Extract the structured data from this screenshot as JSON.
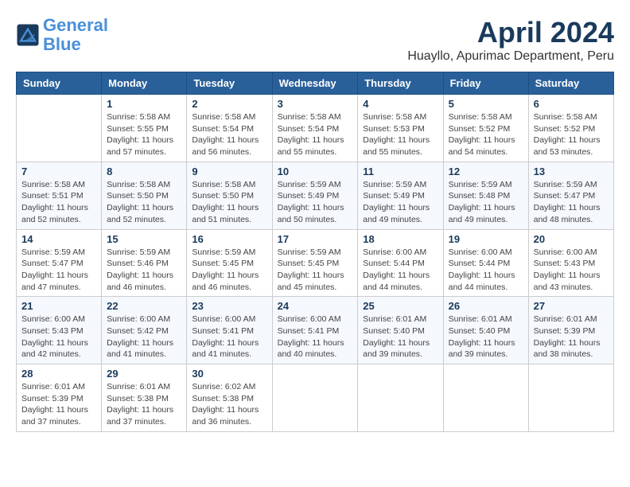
{
  "header": {
    "logo_line1": "General",
    "logo_line2": "Blue",
    "title": "April 2024",
    "location": "Huayllo, Apurimac Department, Peru"
  },
  "days_of_week": [
    "Sunday",
    "Monday",
    "Tuesday",
    "Wednesday",
    "Thursday",
    "Friday",
    "Saturday"
  ],
  "weeks": [
    [
      {
        "day": "",
        "info": ""
      },
      {
        "day": "1",
        "info": "Sunrise: 5:58 AM\nSunset: 5:55 PM\nDaylight: 11 hours\nand 57 minutes."
      },
      {
        "day": "2",
        "info": "Sunrise: 5:58 AM\nSunset: 5:54 PM\nDaylight: 11 hours\nand 56 minutes."
      },
      {
        "day": "3",
        "info": "Sunrise: 5:58 AM\nSunset: 5:54 PM\nDaylight: 11 hours\nand 55 minutes."
      },
      {
        "day": "4",
        "info": "Sunrise: 5:58 AM\nSunset: 5:53 PM\nDaylight: 11 hours\nand 55 minutes."
      },
      {
        "day": "5",
        "info": "Sunrise: 5:58 AM\nSunset: 5:52 PM\nDaylight: 11 hours\nand 54 minutes."
      },
      {
        "day": "6",
        "info": "Sunrise: 5:58 AM\nSunset: 5:52 PM\nDaylight: 11 hours\nand 53 minutes."
      }
    ],
    [
      {
        "day": "7",
        "info": "Sunrise: 5:58 AM\nSunset: 5:51 PM\nDaylight: 11 hours\nand 52 minutes."
      },
      {
        "day": "8",
        "info": "Sunrise: 5:58 AM\nSunset: 5:50 PM\nDaylight: 11 hours\nand 52 minutes."
      },
      {
        "day": "9",
        "info": "Sunrise: 5:58 AM\nSunset: 5:50 PM\nDaylight: 11 hours\nand 51 minutes."
      },
      {
        "day": "10",
        "info": "Sunrise: 5:59 AM\nSunset: 5:49 PM\nDaylight: 11 hours\nand 50 minutes."
      },
      {
        "day": "11",
        "info": "Sunrise: 5:59 AM\nSunset: 5:49 PM\nDaylight: 11 hours\nand 49 minutes."
      },
      {
        "day": "12",
        "info": "Sunrise: 5:59 AM\nSunset: 5:48 PM\nDaylight: 11 hours\nand 49 minutes."
      },
      {
        "day": "13",
        "info": "Sunrise: 5:59 AM\nSunset: 5:47 PM\nDaylight: 11 hours\nand 48 minutes."
      }
    ],
    [
      {
        "day": "14",
        "info": "Sunrise: 5:59 AM\nSunset: 5:47 PM\nDaylight: 11 hours\nand 47 minutes."
      },
      {
        "day": "15",
        "info": "Sunrise: 5:59 AM\nSunset: 5:46 PM\nDaylight: 11 hours\nand 46 minutes."
      },
      {
        "day": "16",
        "info": "Sunrise: 5:59 AM\nSunset: 5:45 PM\nDaylight: 11 hours\nand 46 minutes."
      },
      {
        "day": "17",
        "info": "Sunrise: 5:59 AM\nSunset: 5:45 PM\nDaylight: 11 hours\nand 45 minutes."
      },
      {
        "day": "18",
        "info": "Sunrise: 6:00 AM\nSunset: 5:44 PM\nDaylight: 11 hours\nand 44 minutes."
      },
      {
        "day": "19",
        "info": "Sunrise: 6:00 AM\nSunset: 5:44 PM\nDaylight: 11 hours\nand 44 minutes."
      },
      {
        "day": "20",
        "info": "Sunrise: 6:00 AM\nSunset: 5:43 PM\nDaylight: 11 hours\nand 43 minutes."
      }
    ],
    [
      {
        "day": "21",
        "info": "Sunrise: 6:00 AM\nSunset: 5:43 PM\nDaylight: 11 hours\nand 42 minutes."
      },
      {
        "day": "22",
        "info": "Sunrise: 6:00 AM\nSunset: 5:42 PM\nDaylight: 11 hours\nand 41 minutes."
      },
      {
        "day": "23",
        "info": "Sunrise: 6:00 AM\nSunset: 5:41 PM\nDaylight: 11 hours\nand 41 minutes."
      },
      {
        "day": "24",
        "info": "Sunrise: 6:00 AM\nSunset: 5:41 PM\nDaylight: 11 hours\nand 40 minutes."
      },
      {
        "day": "25",
        "info": "Sunrise: 6:01 AM\nSunset: 5:40 PM\nDaylight: 11 hours\nand 39 minutes."
      },
      {
        "day": "26",
        "info": "Sunrise: 6:01 AM\nSunset: 5:40 PM\nDaylight: 11 hours\nand 39 minutes."
      },
      {
        "day": "27",
        "info": "Sunrise: 6:01 AM\nSunset: 5:39 PM\nDaylight: 11 hours\nand 38 minutes."
      }
    ],
    [
      {
        "day": "28",
        "info": "Sunrise: 6:01 AM\nSunset: 5:39 PM\nDaylight: 11 hours\nand 37 minutes."
      },
      {
        "day": "29",
        "info": "Sunrise: 6:01 AM\nSunset: 5:38 PM\nDaylight: 11 hours\nand 37 minutes."
      },
      {
        "day": "30",
        "info": "Sunrise: 6:02 AM\nSunset: 5:38 PM\nDaylight: 11 hours\nand 36 minutes."
      },
      {
        "day": "",
        "info": ""
      },
      {
        "day": "",
        "info": ""
      },
      {
        "day": "",
        "info": ""
      },
      {
        "day": "",
        "info": ""
      }
    ]
  ]
}
